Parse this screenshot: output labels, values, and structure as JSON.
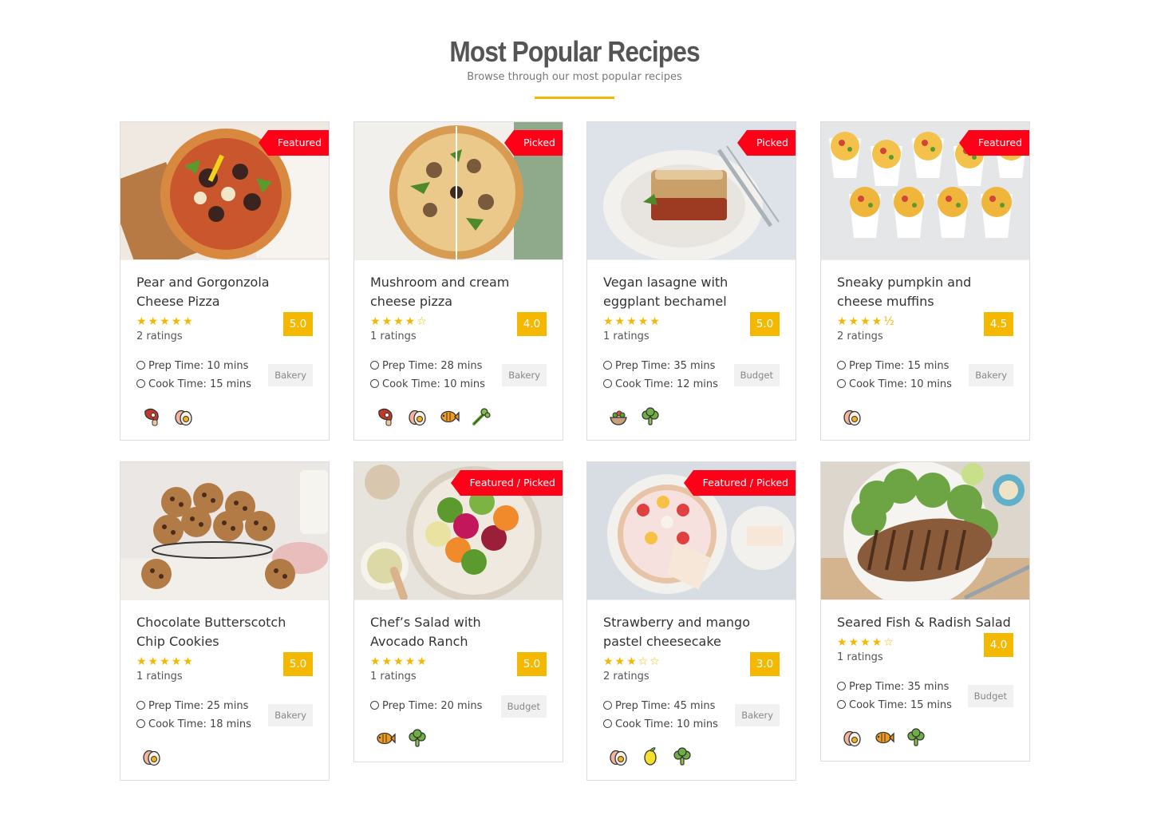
{
  "header": {
    "title": "Most Popular Recipes",
    "subtitle": "Browse through our most popular recipes"
  },
  "recipes": [
    {
      "title": "Pear and Gorgonzola Cheese Pizza",
      "badge": "Featured",
      "stars": "★★★★★",
      "score": "5.0",
      "ratings": "2 ratings",
      "prep": "Prep Time: 10 mins",
      "cook": "Cook Time: 15 mins",
      "category": "Bakery",
      "ingredients": [
        "meat-icon",
        "egg-icon"
      ]
    },
    {
      "title": "Mushroom and cream cheese pizza",
      "badge": "Picked",
      "stars": "★★★★☆",
      "score": "4.0",
      "ratings": "1 ratings",
      "prep": "Prep Time: 28 mins",
      "cook": "Cook Time: 10 mins",
      "category": "Bakery",
      "ingredients": [
        "meat-icon",
        "egg-icon",
        "fish-icon",
        "celery-icon"
      ]
    },
    {
      "title": "Vegan lasagne with eggplant bechamel",
      "badge": "Picked",
      "stars": "★★★★★",
      "score": "5.0",
      "ratings": "1 ratings",
      "prep": "Prep Time: 35 mins",
      "cook": "Cook Time: 12 mins",
      "category": "Budget",
      "ingredients": [
        "salad-bowl-icon",
        "broccoli-icon"
      ]
    },
    {
      "title": "Sneaky pumpkin and cheese muffins",
      "badge": "Featured",
      "stars": "★★★★½",
      "score": "4.5",
      "ratings": "2 ratings",
      "prep": "Prep Time: 15 mins",
      "cook": "Cook Time: 10 mins",
      "category": "Bakery",
      "ingredients": [
        "egg-icon"
      ]
    },
    {
      "title": "Chocolate Butterscotch Chip Cookies",
      "badge": "",
      "stars": "★★★★★",
      "score": "5.0",
      "ratings": "1 ratings",
      "prep": "Prep Time: 25 mins",
      "cook": "Cook Time: 18 mins",
      "category": "Bakery",
      "ingredients": [
        "egg-icon"
      ]
    },
    {
      "title": "Chef’s Salad with Avocado Ranch",
      "badge": "Featured / Picked",
      "stars": "★★★★★",
      "score": "5.0",
      "ratings": "1 ratings",
      "prep": "Prep Time: 20 mins",
      "cook": "",
      "category": "Budget",
      "ingredients": [
        "fish-icon",
        "broccoli-icon"
      ]
    },
    {
      "title": "Strawberry and mango pastel cheesecake",
      "badge": "Featured / Picked",
      "stars": "★★★☆☆",
      "score": "3.0",
      "ratings": "2 ratings",
      "prep": "Prep Time: 45 mins",
      "cook": "Cook Time: 10 mins",
      "category": "Bakery",
      "ingredients": [
        "egg-icon",
        "lemon-icon",
        "broccoli-icon"
      ]
    },
    {
      "title": "Seared Fish & Radish Salad",
      "badge": "",
      "stars": "★★★★☆",
      "score": "4.0",
      "ratings": "1 ratings",
      "prep": "Prep Time: 35 mins",
      "cook": "Cook Time: 15 mins",
      "category": "Budget",
      "ingredients": [
        "egg-icon",
        "fish-icon",
        "broccoli-icon"
      ]
    }
  ],
  "colors": {
    "accent": "#f5b800",
    "ribbon": "#ff0019"
  }
}
